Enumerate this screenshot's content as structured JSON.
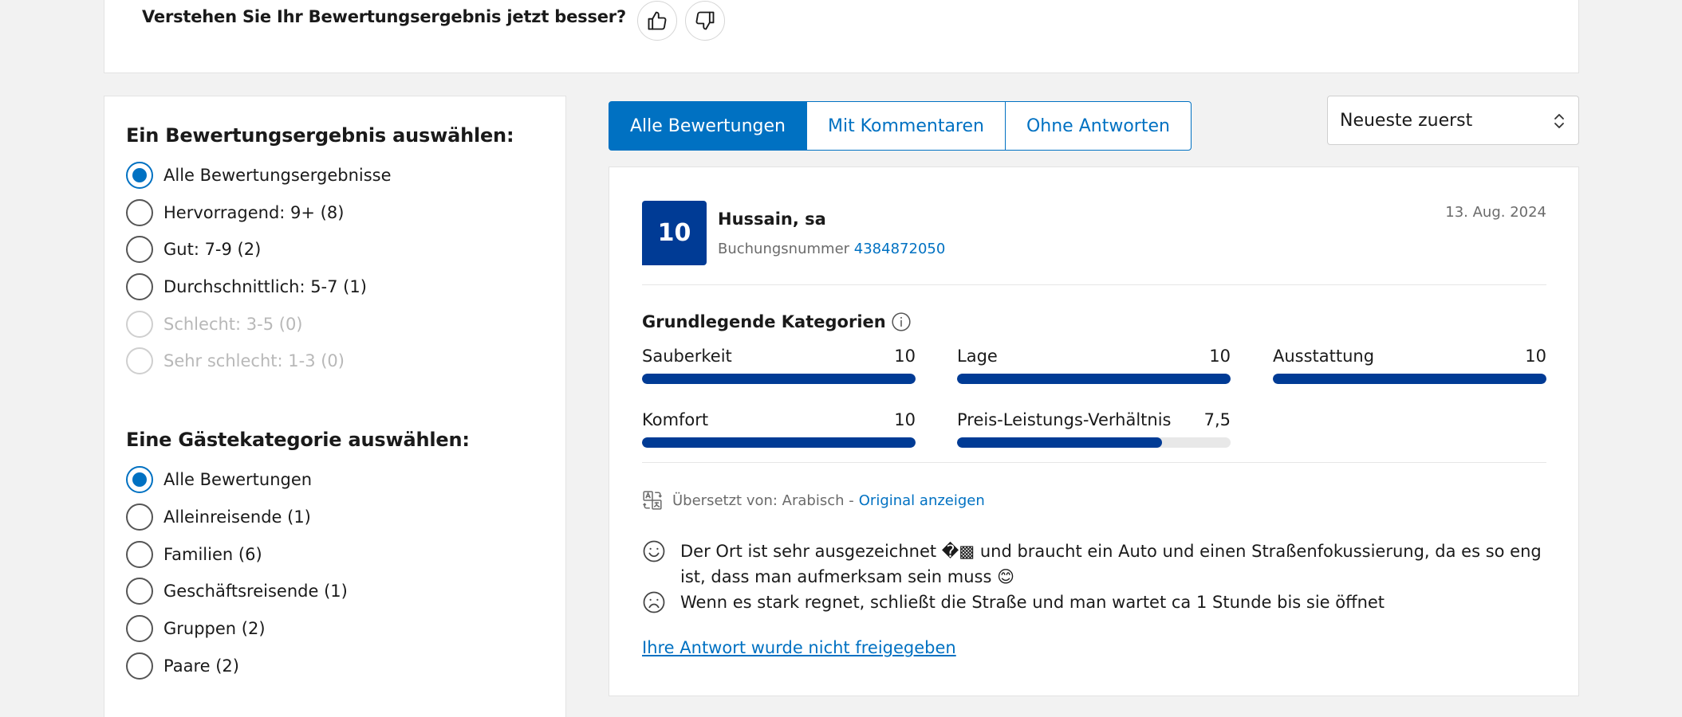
{
  "feedback": {
    "question": "Verstehen Sie Ihr Bewertungsergebnis jetzt besser?"
  },
  "score_filter": {
    "title": "Ein Bewertungsergebnis auswählen:",
    "options": [
      {
        "label": "Alle Bewertungsergebnisse",
        "checked": true,
        "disabled": false
      },
      {
        "label": "Hervorragend: 9+ (8)",
        "checked": false,
        "disabled": false
      },
      {
        "label": "Gut: 7-9 (2)",
        "checked": false,
        "disabled": false
      },
      {
        "label": "Durchschnittlich: 5-7 (1)",
        "checked": false,
        "disabled": false
      },
      {
        "label": "Schlecht: 3-5 (0)",
        "checked": false,
        "disabled": true
      },
      {
        "label": "Sehr schlecht: 1-3 (0)",
        "checked": false,
        "disabled": true
      }
    ]
  },
  "guest_filter": {
    "title": "Eine Gästekategorie auswählen:",
    "options": [
      {
        "label": "Alle Bewertungen",
        "checked": true
      },
      {
        "label": "Alleinreisende (1)",
        "checked": false
      },
      {
        "label": "Familien (6)",
        "checked": false
      },
      {
        "label": "Geschäftsreisende (1)",
        "checked": false
      },
      {
        "label": "Gruppen (2)",
        "checked": false
      },
      {
        "label": "Paare (2)",
        "checked": false
      }
    ]
  },
  "tabs": [
    {
      "label": "Alle Bewertungen",
      "active": true
    },
    {
      "label": "Mit Kommentaren",
      "active": false
    },
    {
      "label": "Ohne Antworten",
      "active": false
    }
  ],
  "sort": {
    "selected": "Neueste zuerst"
  },
  "review": {
    "score": "10",
    "reviewer": "Hussain, sa",
    "booking_label": "Buchungsnummer",
    "booking_number": "4384872050",
    "date": "13. Aug. 2024",
    "categories_title": "Grundlegende Kategorien",
    "categories": [
      {
        "label": "Sauberkeit",
        "score": "10",
        "fraction": 1.0
      },
      {
        "label": "Lage",
        "score": "10",
        "fraction": 1.0
      },
      {
        "label": "Ausstattung",
        "score": "10",
        "fraction": 1.0
      },
      {
        "label": "Komfort",
        "score": "10",
        "fraction": 1.0
      },
      {
        "label": "Preis-Leistungs-Verhältnis",
        "score": "7,5",
        "fraction": 0.75
      }
    ],
    "translated_label": "Übersetzt von: Arabisch -",
    "translated_link": "Original anzeigen",
    "positive_line1": "Der Ort ist sehr ausgezeichnet �▩ und braucht ein Auto und einen Straßenfokussierung, da es so eng",
    "positive_line2": "ist, dass man aufmerksam sein muss 😊",
    "negative": "Wenn es stark regnet, schließt die Straße und man wartet ca 1 Stunde bis sie öffnet",
    "reply_link": "Ihre Antwort wurde nicht freigegeben"
  },
  "colors": {
    "accent": "#0071c2",
    "brand_dark": "#003b95",
    "bar_track": "#e8e8e8"
  },
  "icons": [
    "thumbs-up-icon",
    "thumbs-down-icon",
    "info-icon",
    "translate-icon",
    "smile-face-icon",
    "sad-face-icon",
    "sort-chevron-icon"
  ]
}
